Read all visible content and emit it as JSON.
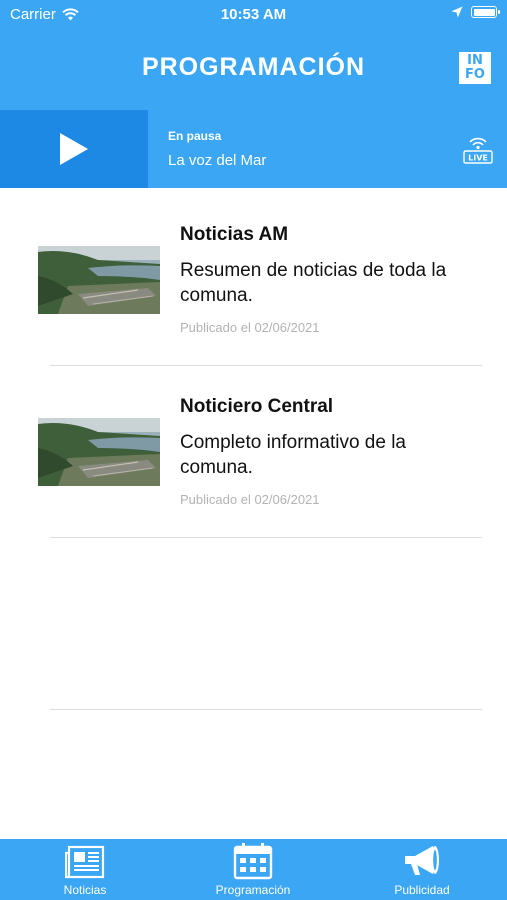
{
  "status_bar": {
    "carrier": "Carrier",
    "time": "10:53 AM"
  },
  "header": {
    "title": "PROGRAMACIÓN",
    "info_letters": [
      "IN",
      "FO"
    ]
  },
  "player": {
    "status": "En pausa",
    "station": "La voz del Mar",
    "live_label": "LIVE"
  },
  "programs": [
    {
      "title": "Noticias AM",
      "description": "Resumen de noticias de toda la comuna.",
      "date": "Publicado el 02/06/2021"
    },
    {
      "title": "Noticiero Central",
      "description": "Completo informativo de la comuna.",
      "date": "Publicado el 02/06/2021"
    }
  ],
  "tabbar": {
    "items": [
      {
        "label": "Noticias",
        "icon": "newspaper-icon"
      },
      {
        "label": "Programación",
        "icon": "calendar-icon"
      },
      {
        "label": "Publicidad",
        "icon": "megaphone-icon"
      }
    ]
  },
  "colors": {
    "primary": "#3aa6f4",
    "primary_dark": "#1e88e5",
    "muted": "#b3b3b3"
  }
}
